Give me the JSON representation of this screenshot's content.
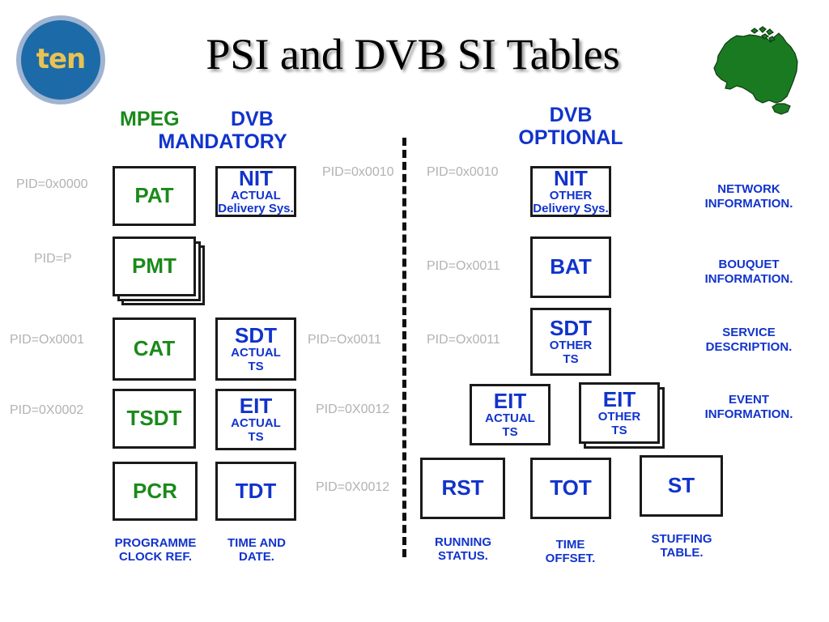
{
  "slide": {
    "title": "PSI and DVB SI Tables",
    "logo_word": "ten",
    "logo_icon": "ten-circle-logo",
    "map_icon": "australia-map-icon"
  },
  "headings": {
    "mpeg": "MPEG",
    "dvb": "DVB",
    "mandatory": "MANDATORY",
    "optional": "DVB\nOPTIONAL",
    "optional_line1": "DVB",
    "optional_line2": "OPTIONAL"
  },
  "colors": {
    "green": "#1a8a1a",
    "blue": "#1133cc",
    "gray": "#b2b2b2",
    "logo_blue": "#1d6aa8",
    "logo_gold": "#e8c353",
    "map_green": "#1a7a22"
  },
  "pids": {
    "left": [
      "PID=0x0000",
      "PID=P",
      "PID=Ox0001",
      "PID=0X0002"
    ],
    "mid_left": [
      "PID=0x0010",
      "PID=Ox0011",
      "PID=0X0012",
      "PID=0X0012"
    ],
    "mid_right": [
      "PID=0x0010",
      "PID=Ox0011",
      "PID=Ox0011"
    ]
  },
  "mpeg_boxes": [
    {
      "main": "PAT",
      "sub": "",
      "sub2": ""
    },
    {
      "main": "PMT",
      "sub": "",
      "sub2": ""
    },
    {
      "main": "CAT",
      "sub": "",
      "sub2": ""
    },
    {
      "main": "TSDT",
      "sub": "",
      "sub2": ""
    },
    {
      "main": "PCR",
      "sub": "",
      "sub2": ""
    }
  ],
  "dvb_mandatory_boxes": [
    {
      "main": "NIT",
      "sub": "ACTUAL",
      "sub2": "Delivery Sys."
    },
    {
      "main": "SDT",
      "sub": "ACTUAL",
      "sub2": "TS"
    },
    {
      "main": "EIT",
      "sub": "ACTUAL",
      "sub2": "TS"
    },
    {
      "main": "TDT",
      "sub": "",
      "sub2": ""
    }
  ],
  "dvb_optional_boxes": [
    {
      "main": "NIT",
      "sub": "OTHER",
      "sub2": "Delivery Sys."
    },
    {
      "main": "BAT",
      "sub": "",
      "sub2": ""
    },
    {
      "main": "SDT",
      "sub": "OTHER",
      "sub2": "TS"
    },
    {
      "main": "EIT",
      "sub": "ACTUAL",
      "sub2": "TS"
    },
    {
      "main": "EIT",
      "sub": "OTHER",
      "sub2": "TS"
    },
    {
      "main": "RST",
      "sub": "",
      "sub2": ""
    },
    {
      "main": "TOT",
      "sub": "",
      "sub2": ""
    },
    {
      "main": "ST",
      "sub": "",
      "sub2": ""
    }
  ],
  "captions": {
    "pcr_line1": "PROGRAMME",
    "pcr_line2": "CLOCK REF.",
    "tdt_line1": "TIME AND",
    "tdt_line2": "DATE.",
    "rst_line1": "RUNNING",
    "rst_line2": "STATUS.",
    "tot_line1": "TIME",
    "tot_line2": "OFFSET.",
    "st_line1": "STUFFING",
    "st_line2": "TABLE."
  },
  "descriptions": [
    {
      "line1": "NETWORK",
      "line2": "INFORMATION."
    },
    {
      "line1": "BOUQUET",
      "line2": "INFORMATION."
    },
    {
      "line1": "SERVICE",
      "line2": "DESCRIPTION."
    },
    {
      "line1": "EVENT",
      "line2": "INFORMATION."
    }
  ]
}
